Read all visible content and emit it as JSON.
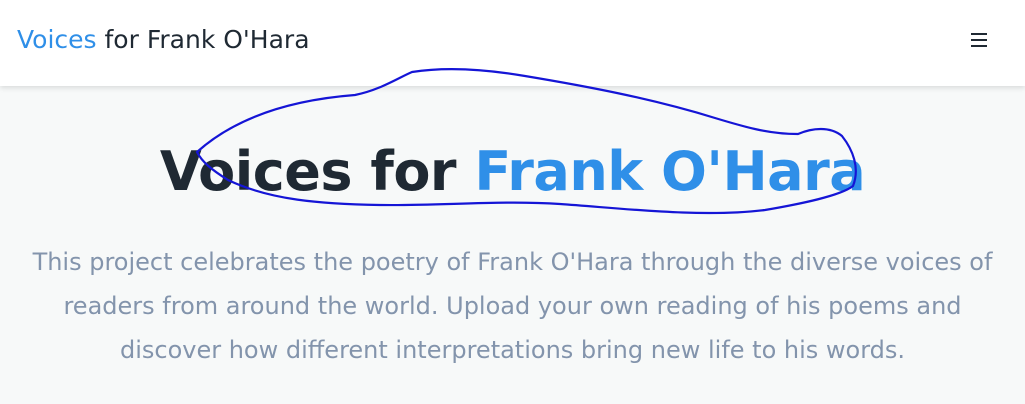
{
  "navbar": {
    "brand_accent": "Voices",
    "brand_rest": " for Frank O'Hara",
    "menu_icon": "hamburger-menu-icon"
  },
  "hero": {
    "title_lead": "Voices for ",
    "title_accent": "Frank O'Hara",
    "description": "This project celebrates the poetry of Frank O'Hara through the diverse voices of readers from around the world. Upload your own reading of his poems and discover how different interpretations bring new life to his words."
  },
  "colors": {
    "accent": "#2f8fe8",
    "heading": "#1f2933",
    "body_text": "#8394ac",
    "annotation_ink": "#1515d6",
    "page_background": "#f7f9f9"
  }
}
